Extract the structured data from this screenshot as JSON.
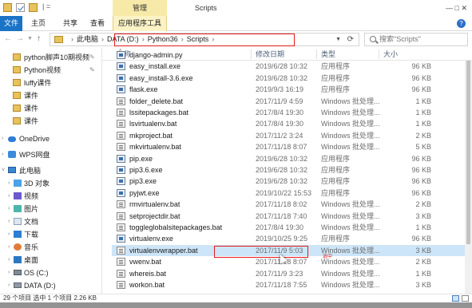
{
  "titlebar": {
    "quick_access_sep": "| =",
    "manage_tab": "管理",
    "window_title": "Scripts",
    "controls": "—   □   ✕"
  },
  "ribbon": {
    "tabs": [
      "文件",
      "主页",
      "共享",
      "查看",
      "应用程序工具"
    ],
    "help": "?"
  },
  "address": {
    "crumbs": [
      "此电脑",
      "DATA (D:)",
      "Python36",
      "Scripts"
    ],
    "search_placeholder": "搜索\"Scripts\""
  },
  "sidebar": {
    "items": [
      {
        "label": "python脚声10期视频",
        "pinned": true
      },
      {
        "label": "Python视频",
        "pinned": true
      },
      {
        "label": "luffy课件",
        "pinned": false
      },
      {
        "label": "课件",
        "pinned": false
      },
      {
        "label": "课件",
        "pinned": false
      },
      {
        "label": "课件",
        "pinned": false
      },
      {
        "label": "OneDrive"
      },
      {
        "label": "WPS网盘"
      },
      {
        "label": "此电脑"
      },
      {
        "label": "3D 对象"
      },
      {
        "label": "视频"
      },
      {
        "label": "图片"
      },
      {
        "label": "文档"
      },
      {
        "label": "下载"
      },
      {
        "label": "音乐"
      },
      {
        "label": "桌面"
      },
      {
        "label": "OS (C:)"
      },
      {
        "label": "DATA (D:)"
      }
    ]
  },
  "columns": {
    "name": "名称",
    "date": "修改日期",
    "type": "类型",
    "size": "大小"
  },
  "files": [
    {
      "name": "django-admin.py",
      "date": "",
      "type": "",
      "size": "",
      "kind": "exe"
    },
    {
      "name": "easy_install.exe",
      "date": "2019/6/28 10:32",
      "type": "应用程序",
      "size": "96 KB",
      "kind": "exe"
    },
    {
      "name": "easy_install-3.6.exe",
      "date": "2019/6/28 10:32",
      "type": "应用程序",
      "size": "96 KB",
      "kind": "exe"
    },
    {
      "name": "flask.exe",
      "date": "2019/9/3 16:19",
      "type": "应用程序",
      "size": "96 KB",
      "kind": "exe"
    },
    {
      "name": "folder_delete.bat",
      "date": "2017/11/9 4:59",
      "type": "Windows 批处理...",
      "size": "1 KB",
      "kind": "bat"
    },
    {
      "name": "lssitepackages.bat",
      "date": "2017/8/4 19:30",
      "type": "Windows 批处理...",
      "size": "1 KB",
      "kind": "bat"
    },
    {
      "name": "lsvirtualenv.bat",
      "date": "2017/8/4 19:30",
      "type": "Windows 批处理...",
      "size": "1 KB",
      "kind": "bat"
    },
    {
      "name": "mkproject.bat",
      "date": "2017/11/2 3:24",
      "type": "Windows 批处理...",
      "size": "2 KB",
      "kind": "bat"
    },
    {
      "name": "mkvirtualenv.bat",
      "date": "2017/11/18 8:07",
      "type": "Windows 批处理...",
      "size": "5 KB",
      "kind": "bat"
    },
    {
      "name": "pip.exe",
      "date": "2019/6/28 10:32",
      "type": "应用程序",
      "size": "96 KB",
      "kind": "exe"
    },
    {
      "name": "pip3.6.exe",
      "date": "2019/6/28 10:32",
      "type": "应用程序",
      "size": "96 KB",
      "kind": "exe"
    },
    {
      "name": "pip3.exe",
      "date": "2019/6/28 10:32",
      "type": "应用程序",
      "size": "96 KB",
      "kind": "exe"
    },
    {
      "name": "pyjwt.exe",
      "date": "2019/10/22 15:53",
      "type": "应用程序",
      "size": "96 KB",
      "kind": "exe"
    },
    {
      "name": "rmvirtualenv.bat",
      "date": "2017/11/18 8:02",
      "type": "Windows 批处理...",
      "size": "2 KB",
      "kind": "bat"
    },
    {
      "name": "setprojectdir.bat",
      "date": "2017/11/18 7:40",
      "type": "Windows 批处理...",
      "size": "3 KB",
      "kind": "bat"
    },
    {
      "name": "toggleglobalsitepackages.bat",
      "date": "2017/8/4 19:30",
      "type": "Windows 批处理...",
      "size": "1 KB",
      "kind": "bat"
    },
    {
      "name": "virtualenv.exe",
      "date": "2019/10/25 9:25",
      "type": "应用程序",
      "size": "96 KB",
      "kind": "exe"
    },
    {
      "name": "virtualenvwrapper.bat",
      "date": "2017/11/9 5:03",
      "type": "Windows 批处理...",
      "size": "3 KB",
      "kind": "bat",
      "selected": true
    },
    {
      "name": "vwenv.bat",
      "date": "2017/11/18 8:07",
      "type": "Windows 批处理...",
      "size": "2 KB",
      "kind": "bat"
    },
    {
      "name": "whereis.bat",
      "date": "2017/11/9 3:23",
      "type": "Windows 批处理...",
      "size": "1 KB",
      "kind": "bat"
    },
    {
      "name": "workon.bat",
      "date": "2017/11/18 7:55",
      "type": "Windows 批处理...",
      "size": "3 KB",
      "kind": "bat"
    }
  ],
  "annotation_note": "选中",
  "status": {
    "text": "29 个项目   选中 1 个项目  2.26 KB"
  },
  "colors": {
    "accent": "#1a73c7",
    "selection": "#cde5f8",
    "highlight_box": "#e21c1c",
    "manage_tab": "#f7e9a8"
  }
}
